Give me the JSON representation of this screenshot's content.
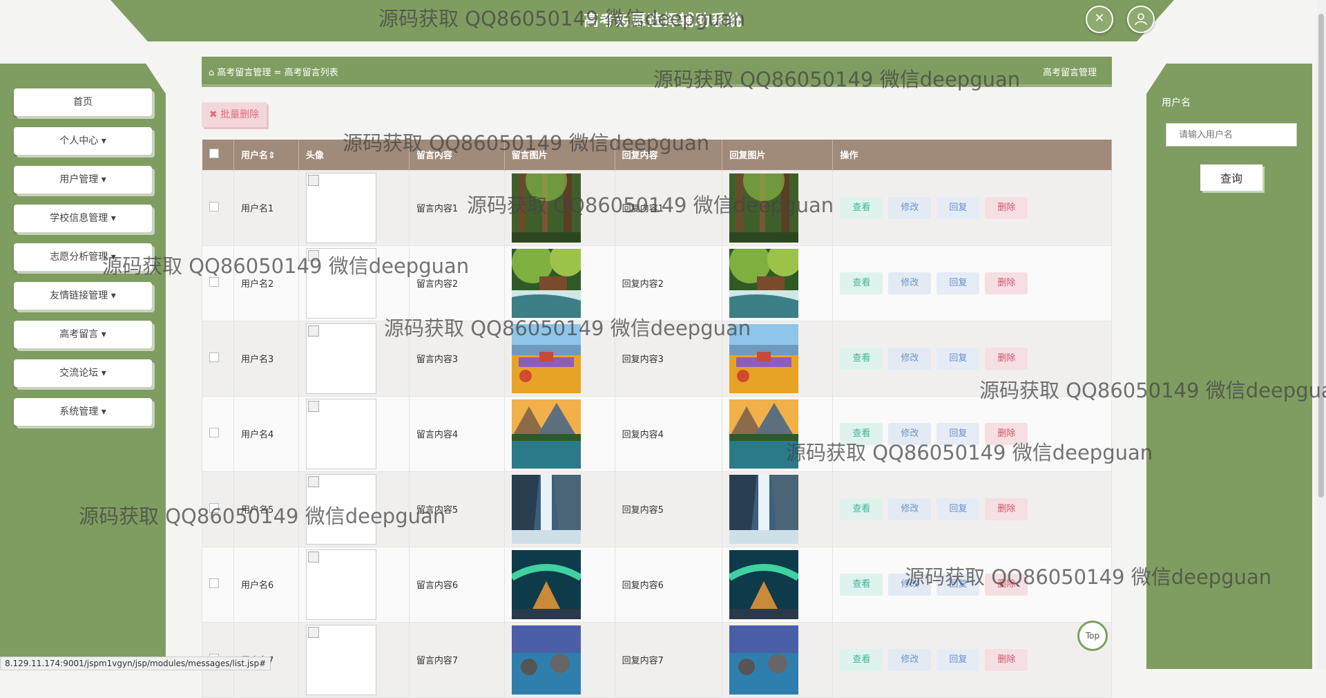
{
  "header": {
    "app_title": "高考志愿选择辅助系统",
    "close_icon": "close-icon",
    "user_icon": "user-icon"
  },
  "sidebar": {
    "items": [
      {
        "label": "首页"
      },
      {
        "label": "个人中心 ▾"
      },
      {
        "label": "用户管理 ▾"
      },
      {
        "label": "学校信息管理 ▾"
      },
      {
        "label": "志愿分析管理 ▾"
      },
      {
        "label": "友情链接管理 ▾"
      },
      {
        "label": "高考留言 ▾"
      },
      {
        "label": "交流论坛 ▾"
      },
      {
        "label": "系统管理 ▾"
      }
    ]
  },
  "breadcrumb": {
    "home_icon": "home-icon",
    "path": "高考留言管理 = 高考留言列表",
    "right_title": "高考留言管理"
  },
  "toolbar": {
    "batch_delete": "✖ 批量删除"
  },
  "table": {
    "headers": [
      "",
      "用户名⇕",
      "头像",
      "留言内容",
      "留言图片",
      "回复内容",
      "回复图片",
      "操作"
    ],
    "actions": {
      "view": "查看",
      "edit": "修改",
      "reply": "回复",
      "delete": "删除"
    },
    "rows": [
      {
        "username": "用户名1",
        "content": "留言内容1",
        "reply": "回复内容1"
      },
      {
        "username": "用户名2",
        "content": "留言内容2",
        "reply": "回复内容2"
      },
      {
        "username": "用户名3",
        "content": "留言内容3",
        "reply": "回复内容3"
      },
      {
        "username": "用户名4",
        "content": "留言内容4",
        "reply": "回复内容4"
      },
      {
        "username": "用户名5",
        "content": "留言内容5",
        "reply": "回复内容5"
      },
      {
        "username": "用户名6",
        "content": "留言内容6",
        "reply": "回复内容6"
      },
      {
        "username": "用户名7",
        "content": "留言内容7",
        "reply": "回复内容7"
      }
    ]
  },
  "search": {
    "label": "用户名",
    "placeholder": "请输入用户名",
    "button": "查询"
  },
  "top_button": "Top",
  "status_url": "8.129.11.174:9001/jspm1vgyn/jsp/modules/messages/list.jsp#",
  "watermark_text": "源码获取 QQ86050149 微信deepguan"
}
